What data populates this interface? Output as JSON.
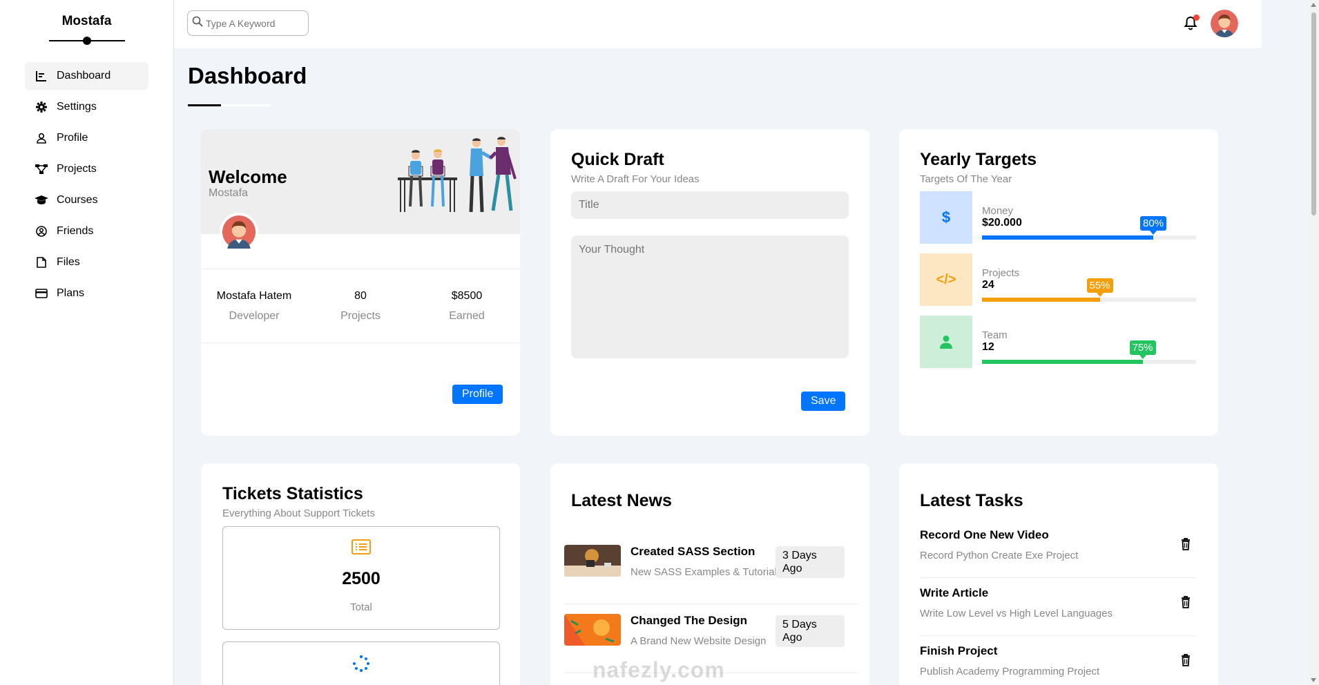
{
  "sidebar": {
    "brand": "Mostafa",
    "items": [
      {
        "label": "Dashboard",
        "icon": "chart-icon",
        "active": true
      },
      {
        "label": "Settings",
        "icon": "gear-icon"
      },
      {
        "label": "Profile",
        "icon": "user-icon"
      },
      {
        "label": "Projects",
        "icon": "diagram-icon"
      },
      {
        "label": "Courses",
        "icon": "graduation-cap-icon"
      },
      {
        "label": "Friends",
        "icon": "user-circle-icon"
      },
      {
        "label": "Files",
        "icon": "file-icon"
      },
      {
        "label": "Plans",
        "icon": "credit-card-icon"
      }
    ]
  },
  "header": {
    "search_placeholder": "Type A Keyword"
  },
  "page": {
    "title": "Dashboard"
  },
  "welcome": {
    "title": "Welcome",
    "name": "Mostafa",
    "stats": [
      {
        "value": "Mostafa Hatem",
        "label": "Developer"
      },
      {
        "value": "80",
        "label": "Projects"
      },
      {
        "value": "$8500",
        "label": "Earned"
      }
    ],
    "button": "Profile"
  },
  "draft": {
    "title": "Quick Draft",
    "subtitle": "Write A Draft For Your Ideas",
    "title_placeholder": "Title",
    "thought_placeholder": "Your Thought",
    "button": "Save"
  },
  "targets": {
    "title": "Yearly Targets",
    "subtitle": "Targets Of The Year",
    "items": [
      {
        "label": "Money",
        "value": "$20.000",
        "percent": 80,
        "percent_label": "80%",
        "color": "#0075ff",
        "bg": "#cfe2ff",
        "icon": "dollar-icon",
        "glyph": "$"
      },
      {
        "label": "Projects",
        "value": "24",
        "percent": 55,
        "percent_label": "55%",
        "color": "#f59e0b",
        "bg": "#fde7c3",
        "icon": "code-icon",
        "glyph": "</>"
      },
      {
        "label": "Team",
        "value": "12",
        "percent": 75,
        "percent_label": "75%",
        "color": "#22c55e",
        "bg": "#cdeed9",
        "icon": "user-icon",
        "glyph": ""
      }
    ]
  },
  "tickets": {
    "title": "Tickets Statistics",
    "subtitle": "Everything About Support Tickets",
    "total_value": "2500",
    "total_label": "Total"
  },
  "news": {
    "title": "Latest News",
    "items": [
      {
        "title": "Created SASS Section",
        "desc": "New SASS Examples & Tutorials",
        "ago": "3 Days Ago"
      },
      {
        "title": "Changed The Design",
        "desc": "A Brand New Website Design",
        "ago": "5 Days Ago"
      }
    ]
  },
  "tasks": {
    "title": "Latest Tasks",
    "items": [
      {
        "title": "Record One New Video",
        "desc": "Record Python Create Exe Project"
      },
      {
        "title": "Write Article",
        "desc": "Write Low Level vs High Level Languages"
      },
      {
        "title": "Finish Project",
        "desc": "Publish Academy Programming Project"
      }
    ]
  },
  "watermark": "nafezly.com",
  "colors": {
    "primary": "#0075ff",
    "background": "#f1f4f9"
  }
}
